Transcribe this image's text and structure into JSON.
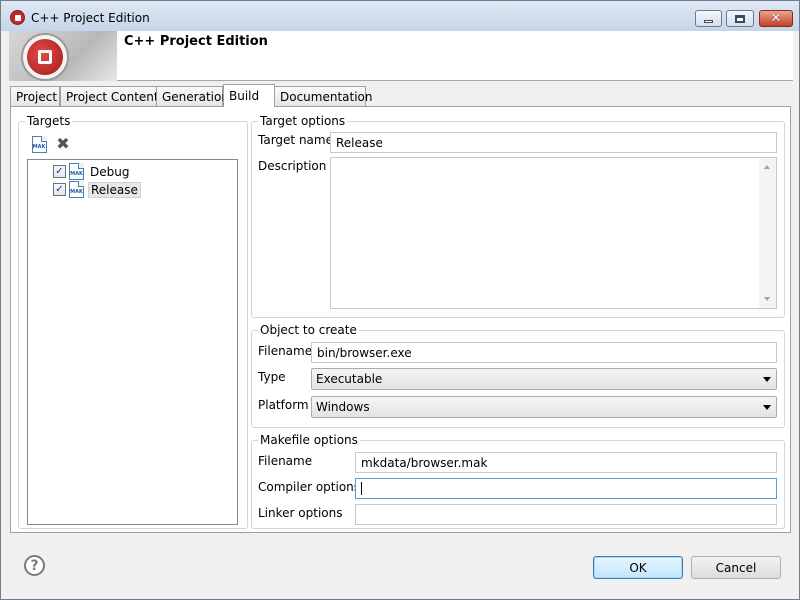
{
  "window": {
    "title": "C++ Project Edition"
  },
  "banner": {
    "title": "C++ Project Edition"
  },
  "tabs": [
    {
      "label": "Project",
      "active": false
    },
    {
      "label": "Project Content",
      "active": false
    },
    {
      "label": "Generation",
      "active": false
    },
    {
      "label": "Build",
      "active": true
    },
    {
      "label": "Documentation",
      "active": false
    }
  ],
  "targets": {
    "group_title": "Targets",
    "add_icon": "mak-file-icon",
    "delete_icon": "delete-x-icon",
    "items": [
      {
        "label": "Debug",
        "checked": true,
        "selected": false
      },
      {
        "label": "Release",
        "checked": true,
        "selected": true
      }
    ]
  },
  "target_options": {
    "group_title": "Target options",
    "target_name_label": "Target name",
    "target_name_value": "Release",
    "description_label": "Description",
    "description_value": ""
  },
  "object_to_create": {
    "group_title": "Object to create",
    "filename_label": "Filename",
    "filename_value": "bin/browser.exe",
    "type_label": "Type",
    "type_value": "Executable",
    "platform_label": "Platform",
    "platform_value": "Windows"
  },
  "makefile_options": {
    "group_title": "Makefile options",
    "filename_label": "Filename",
    "filename_value": "mkdata/browser.mak",
    "compiler_label": "Compiler options",
    "compiler_value": "",
    "linker_label": "Linker options",
    "linker_value": ""
  },
  "footer": {
    "help_icon": "help-question-icon",
    "ok_label": "OK",
    "cancel_label": "Cancel"
  },
  "icons": {
    "mak_label": "MAK"
  },
  "colors": {
    "accent": "#c0282c",
    "focus": "#5b9bd5"
  }
}
